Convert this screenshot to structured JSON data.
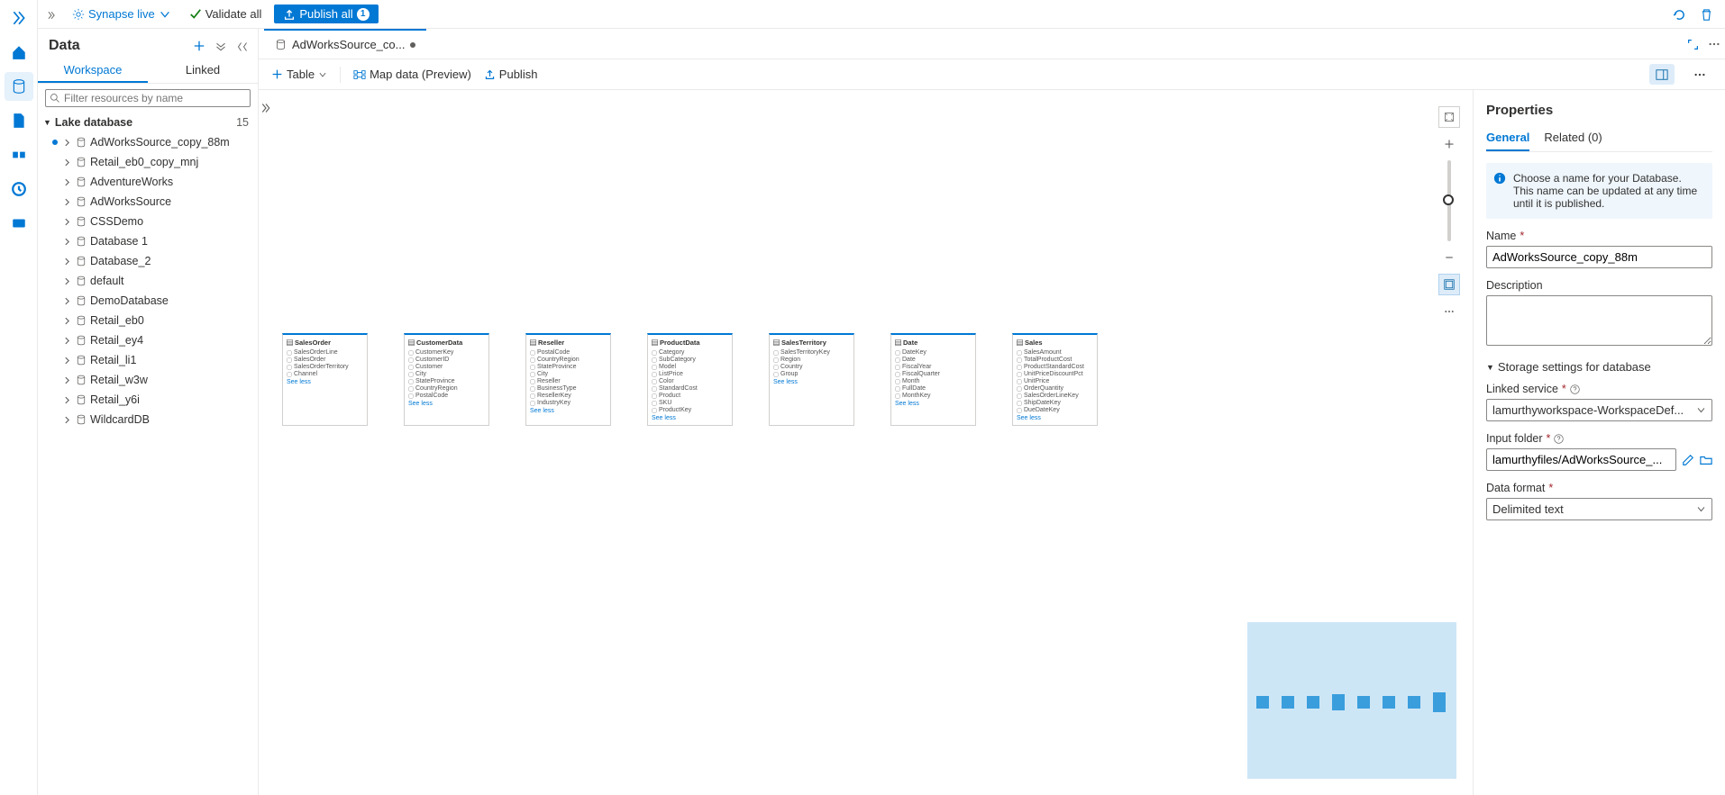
{
  "topbar": {
    "liveLabel": "Synapse live",
    "validateLabel": "Validate all",
    "publishLabel": "Publish all",
    "publishBadge": "1"
  },
  "explorer": {
    "title": "Data",
    "tabs": {
      "workspace": "Workspace",
      "linked": "Linked"
    },
    "filterPlaceholder": "Filter resources by name",
    "group": {
      "name": "Lake database",
      "count": "15"
    },
    "items": [
      {
        "name": "AdWorksSource_copy_88m",
        "dirty": true
      },
      {
        "name": "Retail_eb0_copy_mnj"
      },
      {
        "name": "AdventureWorks"
      },
      {
        "name": "AdWorksSource"
      },
      {
        "name": "CSSDemo"
      },
      {
        "name": "Database 1"
      },
      {
        "name": "Database_2"
      },
      {
        "name": "default"
      },
      {
        "name": "DemoDatabase"
      },
      {
        "name": "Retail_eb0"
      },
      {
        "name": "Retail_ey4"
      },
      {
        "name": "Retail_li1"
      },
      {
        "name": "Retail_w3w"
      },
      {
        "name": "Retail_y6i"
      },
      {
        "name": "WildcardDB"
      }
    ]
  },
  "fileTab": {
    "label": "AdWorksSource_co..."
  },
  "editorToolbar": {
    "tableLabel": "Table",
    "mapLabel": "Map data (Preview)",
    "publishLabel": "Publish"
  },
  "tables": [
    {
      "title": "SalesOrder",
      "cols": [
        "SalesOrderLine",
        "SalesOrder",
        "SalesOrderTerritory",
        "Channel"
      ]
    },
    {
      "title": "CustomerData",
      "cols": [
        "CustomerKey",
        "CustomerID",
        "Customer",
        "City",
        "StateProvince",
        "CountryRegion",
        "PostalCode"
      ]
    },
    {
      "title": "Reseller",
      "cols": [
        "PostalCode",
        "CountryRegion",
        "StateProvince",
        "City",
        "Reseller",
        "BusinessType",
        "ResellerKey",
        "IndustryKey"
      ]
    },
    {
      "title": "ProductData",
      "cols": [
        "Category",
        "SubCategory",
        "Model",
        "ListPrice",
        "Color",
        "StandardCost",
        "Product",
        "SKU",
        "ProductKey"
      ]
    },
    {
      "title": "SalesTerritory",
      "cols": [
        "SalesTerritoryKey",
        "Region",
        "Country",
        "Group"
      ]
    },
    {
      "title": "Date",
      "cols": [
        "DateKey",
        "Date",
        "FiscalYear",
        "FiscalQuarter",
        "Month",
        "FullDate",
        "MonthKey"
      ]
    },
    {
      "title": "Sales",
      "cols": [
        "SalesAmount",
        "TotalProductCost",
        "ProductStandardCost",
        "UnitPriceDiscountPct",
        "UnitPrice",
        "OrderQuantity",
        "SalesOrderLineKey",
        "ShipDateKey",
        "DueDateKey"
      ]
    }
  ],
  "seeMoreLabel": "See less",
  "props": {
    "title": "Properties",
    "tabs": {
      "general": "General",
      "related": "Related (0)"
    },
    "info": "Choose a name for your Database. This name can be updated at any time until it is published.",
    "name": {
      "label": "Name",
      "value": "AdWorksSource_copy_88m"
    },
    "description": {
      "label": "Description",
      "value": ""
    },
    "storageHeader": "Storage settings for database",
    "linkedService": {
      "label": "Linked service",
      "value": "lamurthyworkspace-WorkspaceDef..."
    },
    "inputFolder": {
      "label": "Input folder",
      "value": "lamurthyfiles/AdWorksSource_..."
    },
    "dataFormat": {
      "label": "Data format",
      "value": "Delimited text"
    }
  }
}
